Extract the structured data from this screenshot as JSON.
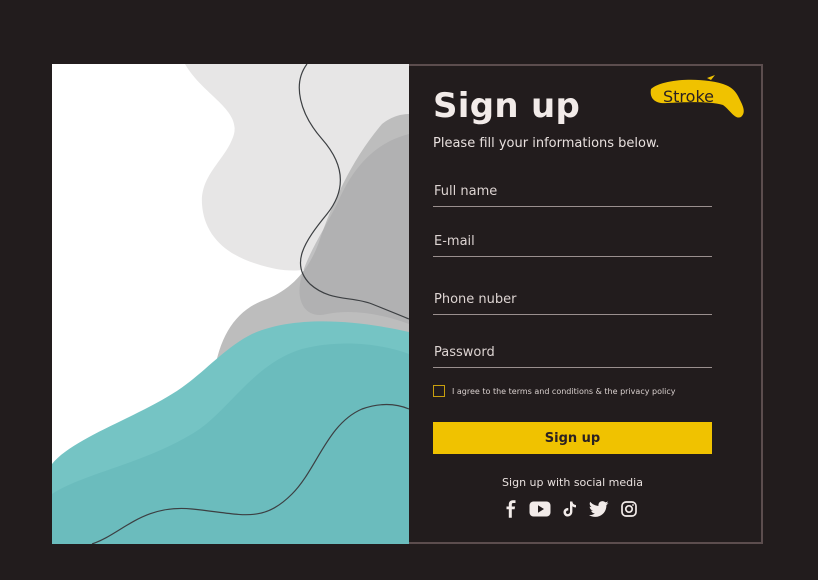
{
  "form": {
    "title": "Sign up",
    "subtitle": "Please fill your informations below.",
    "brand_label": "Stroke",
    "fields": {
      "full_name": {
        "placeholder": "Full name",
        "value": ""
      },
      "email": {
        "placeholder": "E-mail",
        "value": ""
      },
      "phone": {
        "placeholder": "Phone nuber",
        "value": ""
      },
      "password": {
        "placeholder": "Password",
        "value": ""
      }
    },
    "agree_label": "I agree to the terms and conditions & the privacy policy",
    "agree_checked": false,
    "submit_label": "Sign up",
    "social_label": "Sign up with social media",
    "social_icons": [
      "facebook-icon",
      "youtube-icon",
      "tiktok-icon",
      "twitter-icon",
      "instagram-icon"
    ]
  },
  "colors": {
    "background": "#221c1d",
    "card_border": "#5c4d4e",
    "accent_yellow": "#f0c200",
    "text_light": "#f2ebe9",
    "teal": "#6fc3c4"
  }
}
